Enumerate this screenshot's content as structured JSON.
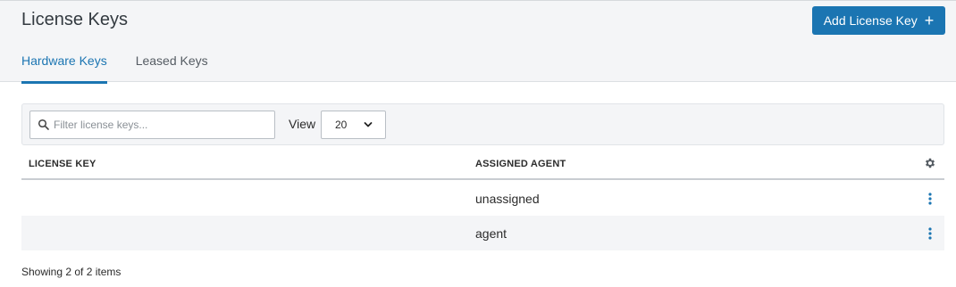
{
  "header": {
    "title": "License Keys",
    "add_button_label": "Add License Key",
    "add_button_icon": "plus-icon",
    "accent_color": "#1b75b2"
  },
  "tabs": [
    {
      "label": "Hardware Keys",
      "active": true
    },
    {
      "label": "Leased Keys",
      "active": false
    }
  ],
  "toolbar": {
    "search_placeholder": "Filter license keys...",
    "search_value": "",
    "view_label": "View",
    "view_selected": "20"
  },
  "table": {
    "columns": [
      "LICENSE KEY",
      "ASSIGNED AGENT"
    ],
    "rows": [
      {
        "license_key": "",
        "assigned_agent": "unassigned"
      },
      {
        "license_key": "",
        "assigned_agent": "agent"
      }
    ]
  },
  "footer": {
    "status": "Showing 2 of 2 items"
  }
}
